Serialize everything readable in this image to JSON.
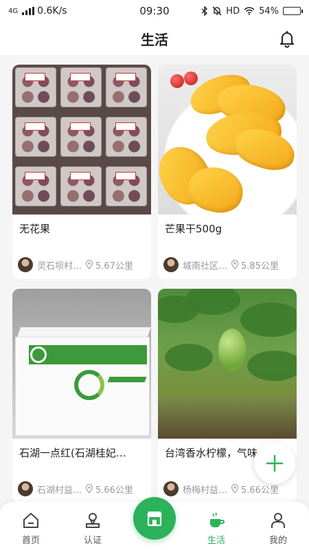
{
  "status_bar": {
    "network": "4G",
    "speed": "0.6K/s",
    "time": "09:30",
    "hd": "HD",
    "battery": "54%",
    "battery_level": 0.54
  },
  "header": {
    "title": "生活"
  },
  "cards": [
    {
      "title": "无花果",
      "village": "灵石坝村…",
      "distance": "5.67公里",
      "image": "figs-in-trays"
    },
    {
      "title": "芒果干500g",
      "village": "城南社区…",
      "distance": "5.85公里",
      "image": "dried-mango-plate"
    },
    {
      "title": "石湖一点红(石湖桂妃…",
      "village": "石湖村益…",
      "distance": "5.66公里",
      "image": "lychee-gift-box"
    },
    {
      "title": "台湾香水柠檬，气味…",
      "village": "杨梅村益…",
      "distance": "5.66公里",
      "image": "lemon-tree"
    }
  ],
  "fab": {
    "icon": "plus-icon"
  },
  "tabbar": {
    "items": [
      {
        "label": "首页",
        "icon": "home-icon",
        "active": false
      },
      {
        "label": "认证",
        "icon": "user-badge-icon",
        "active": false
      },
      {
        "label": "",
        "icon": "shop-icon",
        "active": false
      },
      {
        "label": "生活",
        "icon": "coffee-cup-icon",
        "active": true
      },
      {
        "label": "我的",
        "icon": "person-icon",
        "active": false
      }
    ]
  },
  "colors": {
    "accent": "#2bb25b",
    "text": "#222222",
    "muted": "#999999",
    "background": "#f5f5f5"
  }
}
